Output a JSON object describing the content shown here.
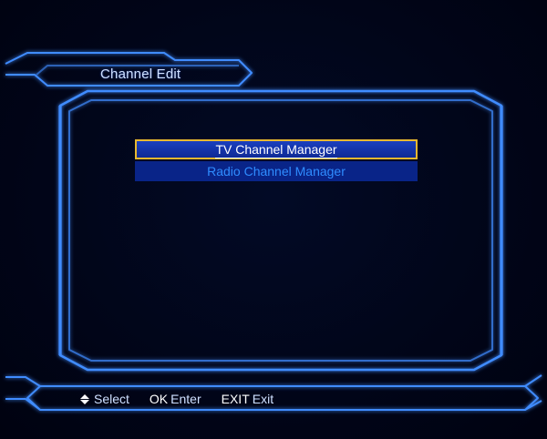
{
  "header": {
    "title": "Channel Edit"
  },
  "menu": {
    "items": [
      {
        "label": "TV Channel Manager",
        "selected": true
      },
      {
        "label": "Radio Channel Manager",
        "selected": false
      }
    ]
  },
  "footer": {
    "select": {
      "icon": "up-down-arrows-icon",
      "label": "Select"
    },
    "ok": {
      "key": "OK",
      "label": "Enter"
    },
    "exit": {
      "key": "EXIT",
      "label": "Exit"
    }
  },
  "colors": {
    "background": "#010314",
    "frame": "#3f8cff",
    "highlight_border": "#e8b830",
    "highlight_fill": "#1a3fbf",
    "item_fill": "#092488",
    "item_text": "#2f8cff"
  }
}
